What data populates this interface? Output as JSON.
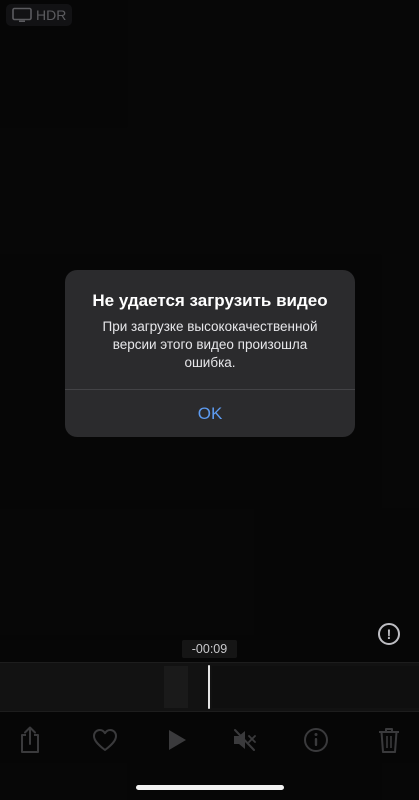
{
  "status": {
    "hdr_label": "HDR"
  },
  "alert": {
    "title": "Не удается загрузить видео",
    "message": "При загрузке высококачественной версии этого видео произошла ошибка.",
    "ok_label": "OK"
  },
  "player": {
    "time_remaining": "-00:09",
    "info_mark": "!"
  },
  "toolbar": {
    "icons": [
      "share-icon",
      "heart-icon",
      "play-icon",
      "mute-icon",
      "info-icon",
      "trash-icon"
    ]
  },
  "colors": {
    "accent": "#5d9bf0",
    "background": "#0a0a0a",
    "alert_bg": "#2b2b2d"
  }
}
